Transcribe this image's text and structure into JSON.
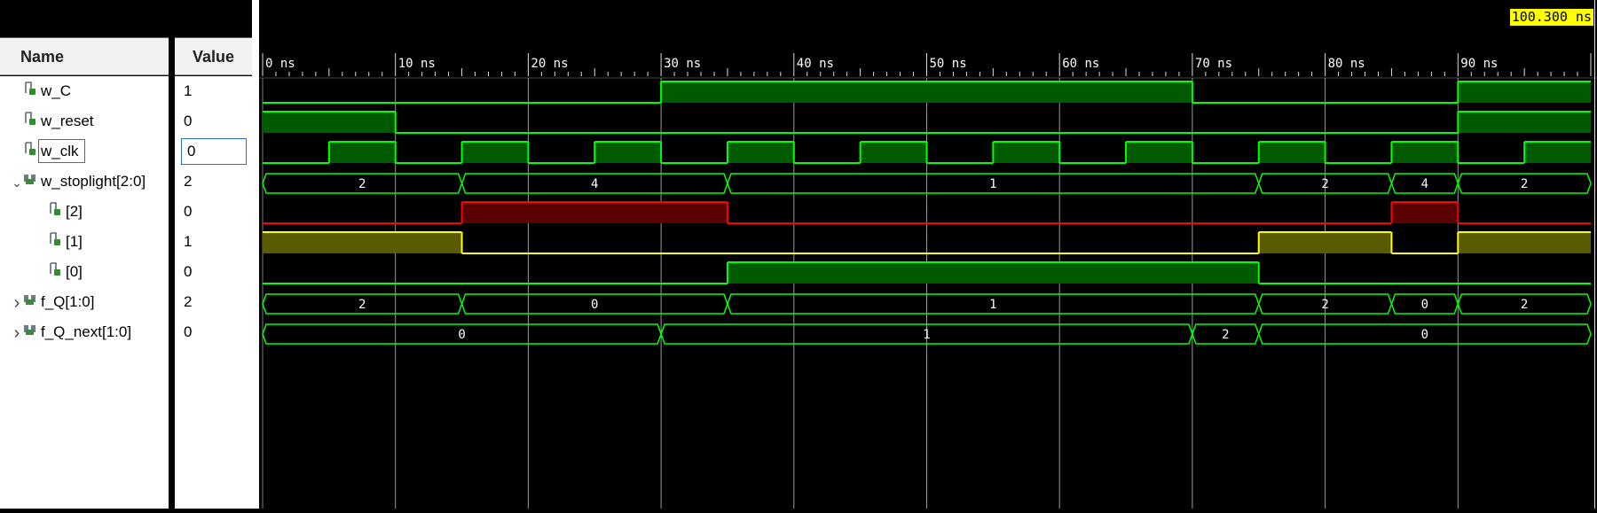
{
  "header": {
    "name_label": "Name",
    "value_label": "Value"
  },
  "cursor": {
    "time_label": "100.300 ns"
  },
  "timeline": {
    "ticks": [
      "0 ns",
      "10 ns",
      "20 ns",
      "30 ns",
      "40 ns",
      "50 ns",
      "60 ns",
      "70 ns",
      "80 ns",
      "90 ns"
    ],
    "range_ns": [
      0,
      100
    ]
  },
  "colors": {
    "green": "#00ff00",
    "green_fill": "#005a00",
    "red": "#ff0000",
    "red_fill": "#5a0000",
    "yellow": "#ffff00",
    "yellow_fill": "#5a5a00",
    "grid": "#9a9a9a"
  },
  "signals": [
    {
      "name": "w_C",
      "value": "1",
      "kind": "bit",
      "indent": 0,
      "expander": "",
      "selected": false,
      "color": "green",
      "transitions": [
        [
          0,
          0
        ],
        [
          30,
          1
        ],
        [
          70,
          0
        ],
        [
          90,
          1
        ]
      ]
    },
    {
      "name": "w_reset",
      "value": "0",
      "kind": "bit",
      "indent": 0,
      "expander": "",
      "selected": false,
      "color": "green",
      "transitions": [
        [
          0,
          1
        ],
        [
          10,
          0
        ],
        [
          90,
          1
        ]
      ]
    },
    {
      "name": "w_clk",
      "value": "0",
      "kind": "bit",
      "indent": 0,
      "expander": "",
      "selected": true,
      "color": "green",
      "transitions": [
        [
          0,
          0
        ],
        [
          5,
          1
        ],
        [
          10,
          0
        ],
        [
          15,
          1
        ],
        [
          20,
          0
        ],
        [
          25,
          1
        ],
        [
          30,
          0
        ],
        [
          35,
          1
        ],
        [
          40,
          0
        ],
        [
          45,
          1
        ],
        [
          50,
          0
        ],
        [
          55,
          1
        ],
        [
          60,
          0
        ],
        [
          65,
          1
        ],
        [
          70,
          0
        ],
        [
          75,
          1
        ],
        [
          80,
          0
        ],
        [
          85,
          1
        ],
        [
          90,
          0
        ],
        [
          95,
          1
        ]
      ]
    },
    {
      "name": "w_stoplight[2:0]",
      "value": "2",
      "kind": "bus",
      "indent": 0,
      "expander": "v",
      "selected": false,
      "color": "green",
      "segments": [
        [
          0,
          15,
          "2"
        ],
        [
          15,
          35,
          "4"
        ],
        [
          35,
          75,
          "1"
        ],
        [
          75,
          85,
          "2"
        ],
        [
          85,
          90,
          "4"
        ],
        [
          90,
          100,
          "2"
        ]
      ]
    },
    {
      "name": "[2]",
      "value": "0",
      "kind": "bit",
      "indent": 1,
      "expander": "",
      "selected": false,
      "color": "red",
      "transitions": [
        [
          0,
          0
        ],
        [
          15,
          1
        ],
        [
          35,
          0
        ],
        [
          85,
          1
        ],
        [
          90,
          0
        ]
      ]
    },
    {
      "name": "[1]",
      "value": "1",
      "kind": "bit",
      "indent": 1,
      "expander": "",
      "selected": false,
      "color": "yellow",
      "transitions": [
        [
          0,
          1
        ],
        [
          15,
          0
        ],
        [
          75,
          1
        ],
        [
          85,
          0
        ],
        [
          90,
          1
        ]
      ]
    },
    {
      "name": "[0]",
      "value": "0",
      "kind": "bit",
      "indent": 1,
      "expander": "",
      "selected": false,
      "color": "green",
      "transitions": [
        [
          0,
          0
        ],
        [
          35,
          1
        ],
        [
          75,
          0
        ]
      ]
    },
    {
      "name": "f_Q[1:0]",
      "value": "2",
      "kind": "bus",
      "indent": 0,
      "expander": ">",
      "selected": false,
      "color": "green",
      "segments": [
        [
          0,
          15,
          "2"
        ],
        [
          15,
          35,
          "0"
        ],
        [
          35,
          75,
          "1"
        ],
        [
          75,
          85,
          "2"
        ],
        [
          85,
          90,
          "0"
        ],
        [
          90,
          100,
          "2"
        ]
      ]
    },
    {
      "name": "f_Q_next[1:0]",
      "value": "0",
      "kind": "bus",
      "indent": 0,
      "expander": ">",
      "selected": false,
      "color": "green",
      "segments": [
        [
          0,
          30,
          "0"
        ],
        [
          30,
          70,
          "1"
        ],
        [
          70,
          75,
          "2"
        ],
        [
          75,
          100,
          "0"
        ]
      ]
    }
  ]
}
